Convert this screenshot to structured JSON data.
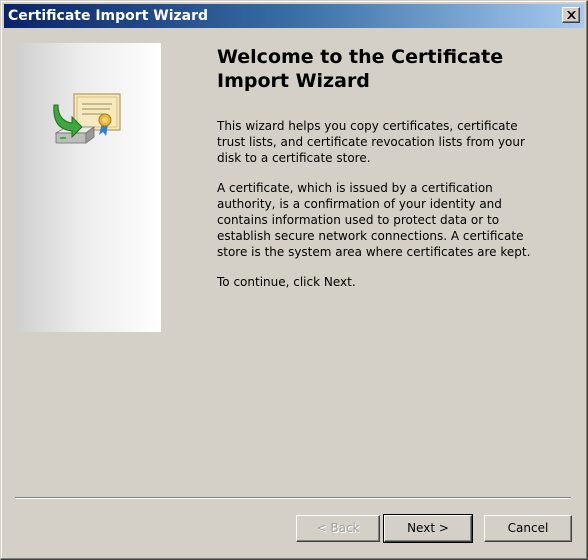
{
  "window": {
    "title": "Certificate Import Wizard"
  },
  "banner": {
    "icon": "certificate-import-icon"
  },
  "content": {
    "heading": "Welcome to the Certificate Import Wizard",
    "paragraphs": [
      "This wizard helps you copy certificates, certificate trust lists, and certificate revocation lists from your disk to a certificate store.",
      "A certificate, which is issued by a certification authority, is a confirmation of your identity and contains information used to protect data or to establish secure network connections. A certificate store is the system area where certificates are kept.",
      "To continue, click Next."
    ]
  },
  "buttons": {
    "back": "< Back",
    "next": "Next >",
    "cancel": "Cancel"
  }
}
